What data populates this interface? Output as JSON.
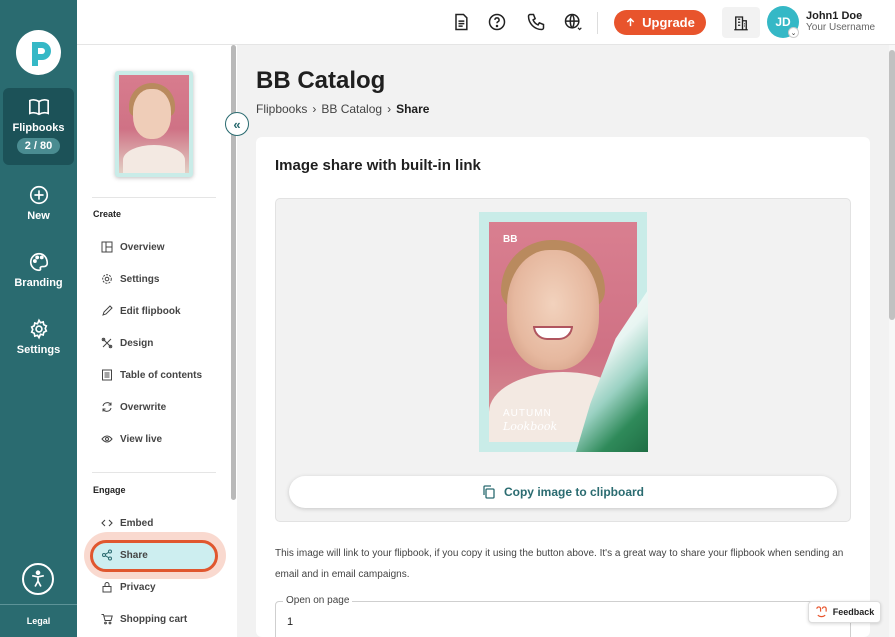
{
  "rail": {
    "items": [
      {
        "label": "Flipbooks",
        "badge": "2 / 80",
        "icon": "book-open-icon"
      },
      {
        "label": "New",
        "icon": "plus-circle-icon"
      },
      {
        "label": "Branding",
        "icon": "palette-icon"
      },
      {
        "label": "Settings",
        "icon": "gear-icon"
      }
    ],
    "legal": "Legal"
  },
  "topbar": {
    "upgrade_label": "Upgrade",
    "avatar_initials": "JD",
    "user_name": "John1 Doe",
    "user_sub": "Your Username"
  },
  "sidebar": {
    "sections": [
      {
        "title": "Create",
        "items": [
          "Overview",
          "Settings",
          "Edit flipbook",
          "Design",
          "Table of contents",
          "Overwrite",
          "View live"
        ]
      },
      {
        "title": "Engage",
        "items": [
          "Embed",
          "Share",
          "Privacy",
          "Shopping cart"
        ]
      }
    ],
    "active_item": "Share"
  },
  "main": {
    "title": "BB Catalog",
    "breadcrumb": [
      "Flipbooks",
      "BB Catalog",
      "Share"
    ],
    "card_title": "Image share with built-in link",
    "cover_text": {
      "brand": "BB",
      "line1": "AUTUMN",
      "line2": "Lookbook"
    },
    "copy_label": "Copy image to clipboard",
    "description": "This image will link to your flipbook, if you copy it using the button above. It's a great way to share your flipbook when sending an email and in email campaigns.",
    "field_label": "Open on page",
    "field_value": "1"
  },
  "feedback_label": "Feedback",
  "colors": {
    "rail": "#2a6b70",
    "accent": "#e8542c",
    "teal": "#2a6b70",
    "avatar": "#35b8c6"
  }
}
